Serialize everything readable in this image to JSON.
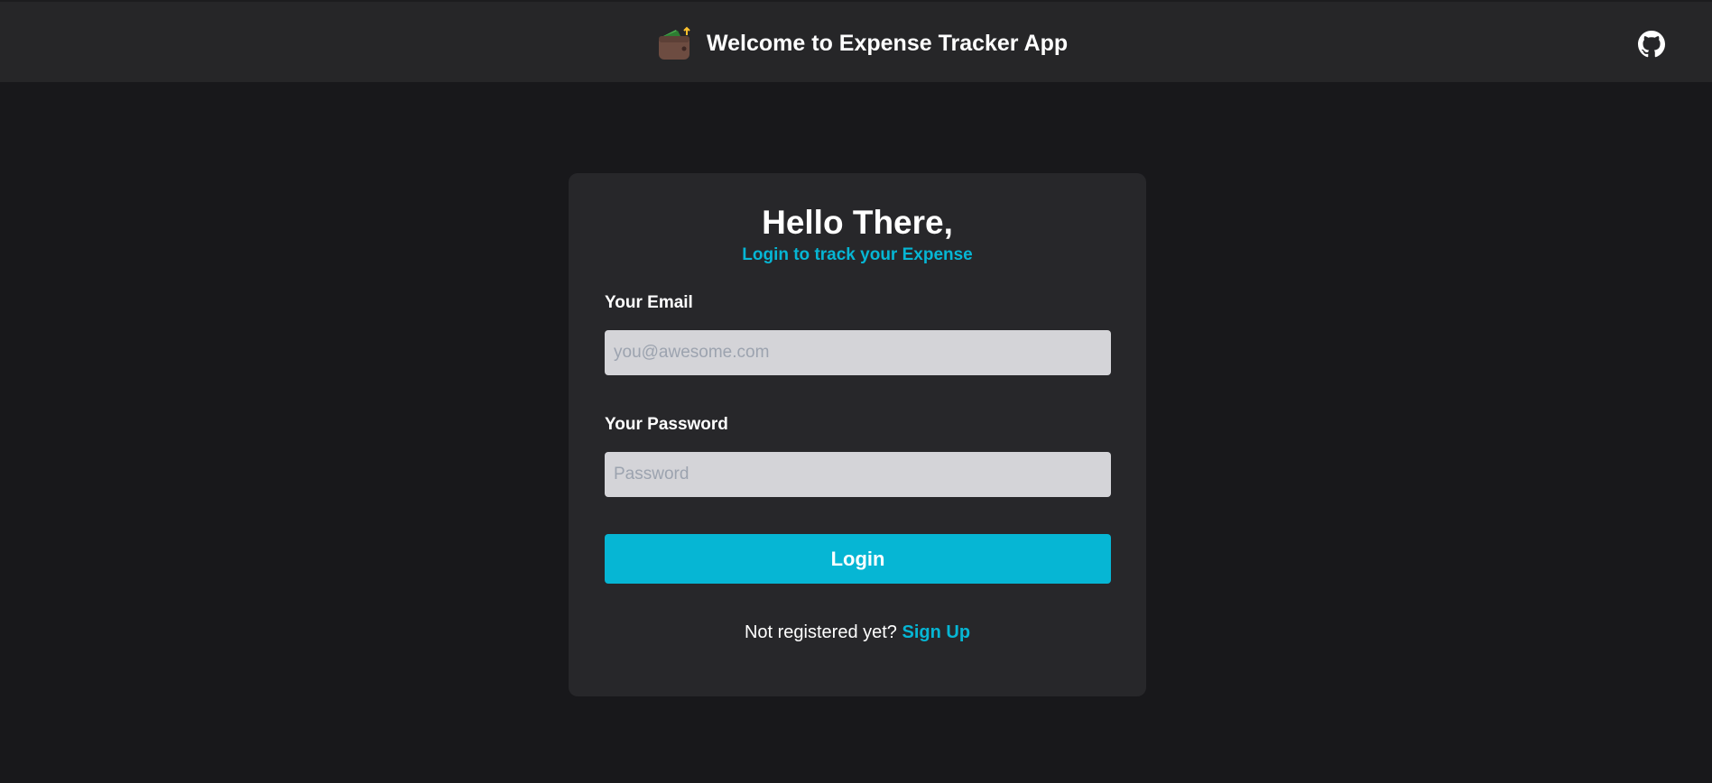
{
  "header": {
    "title": "Welcome to Expense Tracker App",
    "logo_icon": "wallet-icon",
    "github_icon": "github-icon"
  },
  "login_card": {
    "heading": "Hello There,",
    "subheading": "Login to track your Expense",
    "email_label": "Your Email",
    "email_value": "",
    "email_placeholder": "you@awesome.com",
    "password_label": "Your Password",
    "password_value": "",
    "password_placeholder": "Password",
    "login_button": "Login",
    "signup_prompt": "Not registered yet?",
    "signup_link": "Sign Up"
  },
  "colors": {
    "background": "#18181b",
    "header": "#262628",
    "card": "#27272a",
    "accent": "#06b6d4",
    "input": "#d4d4d8"
  }
}
